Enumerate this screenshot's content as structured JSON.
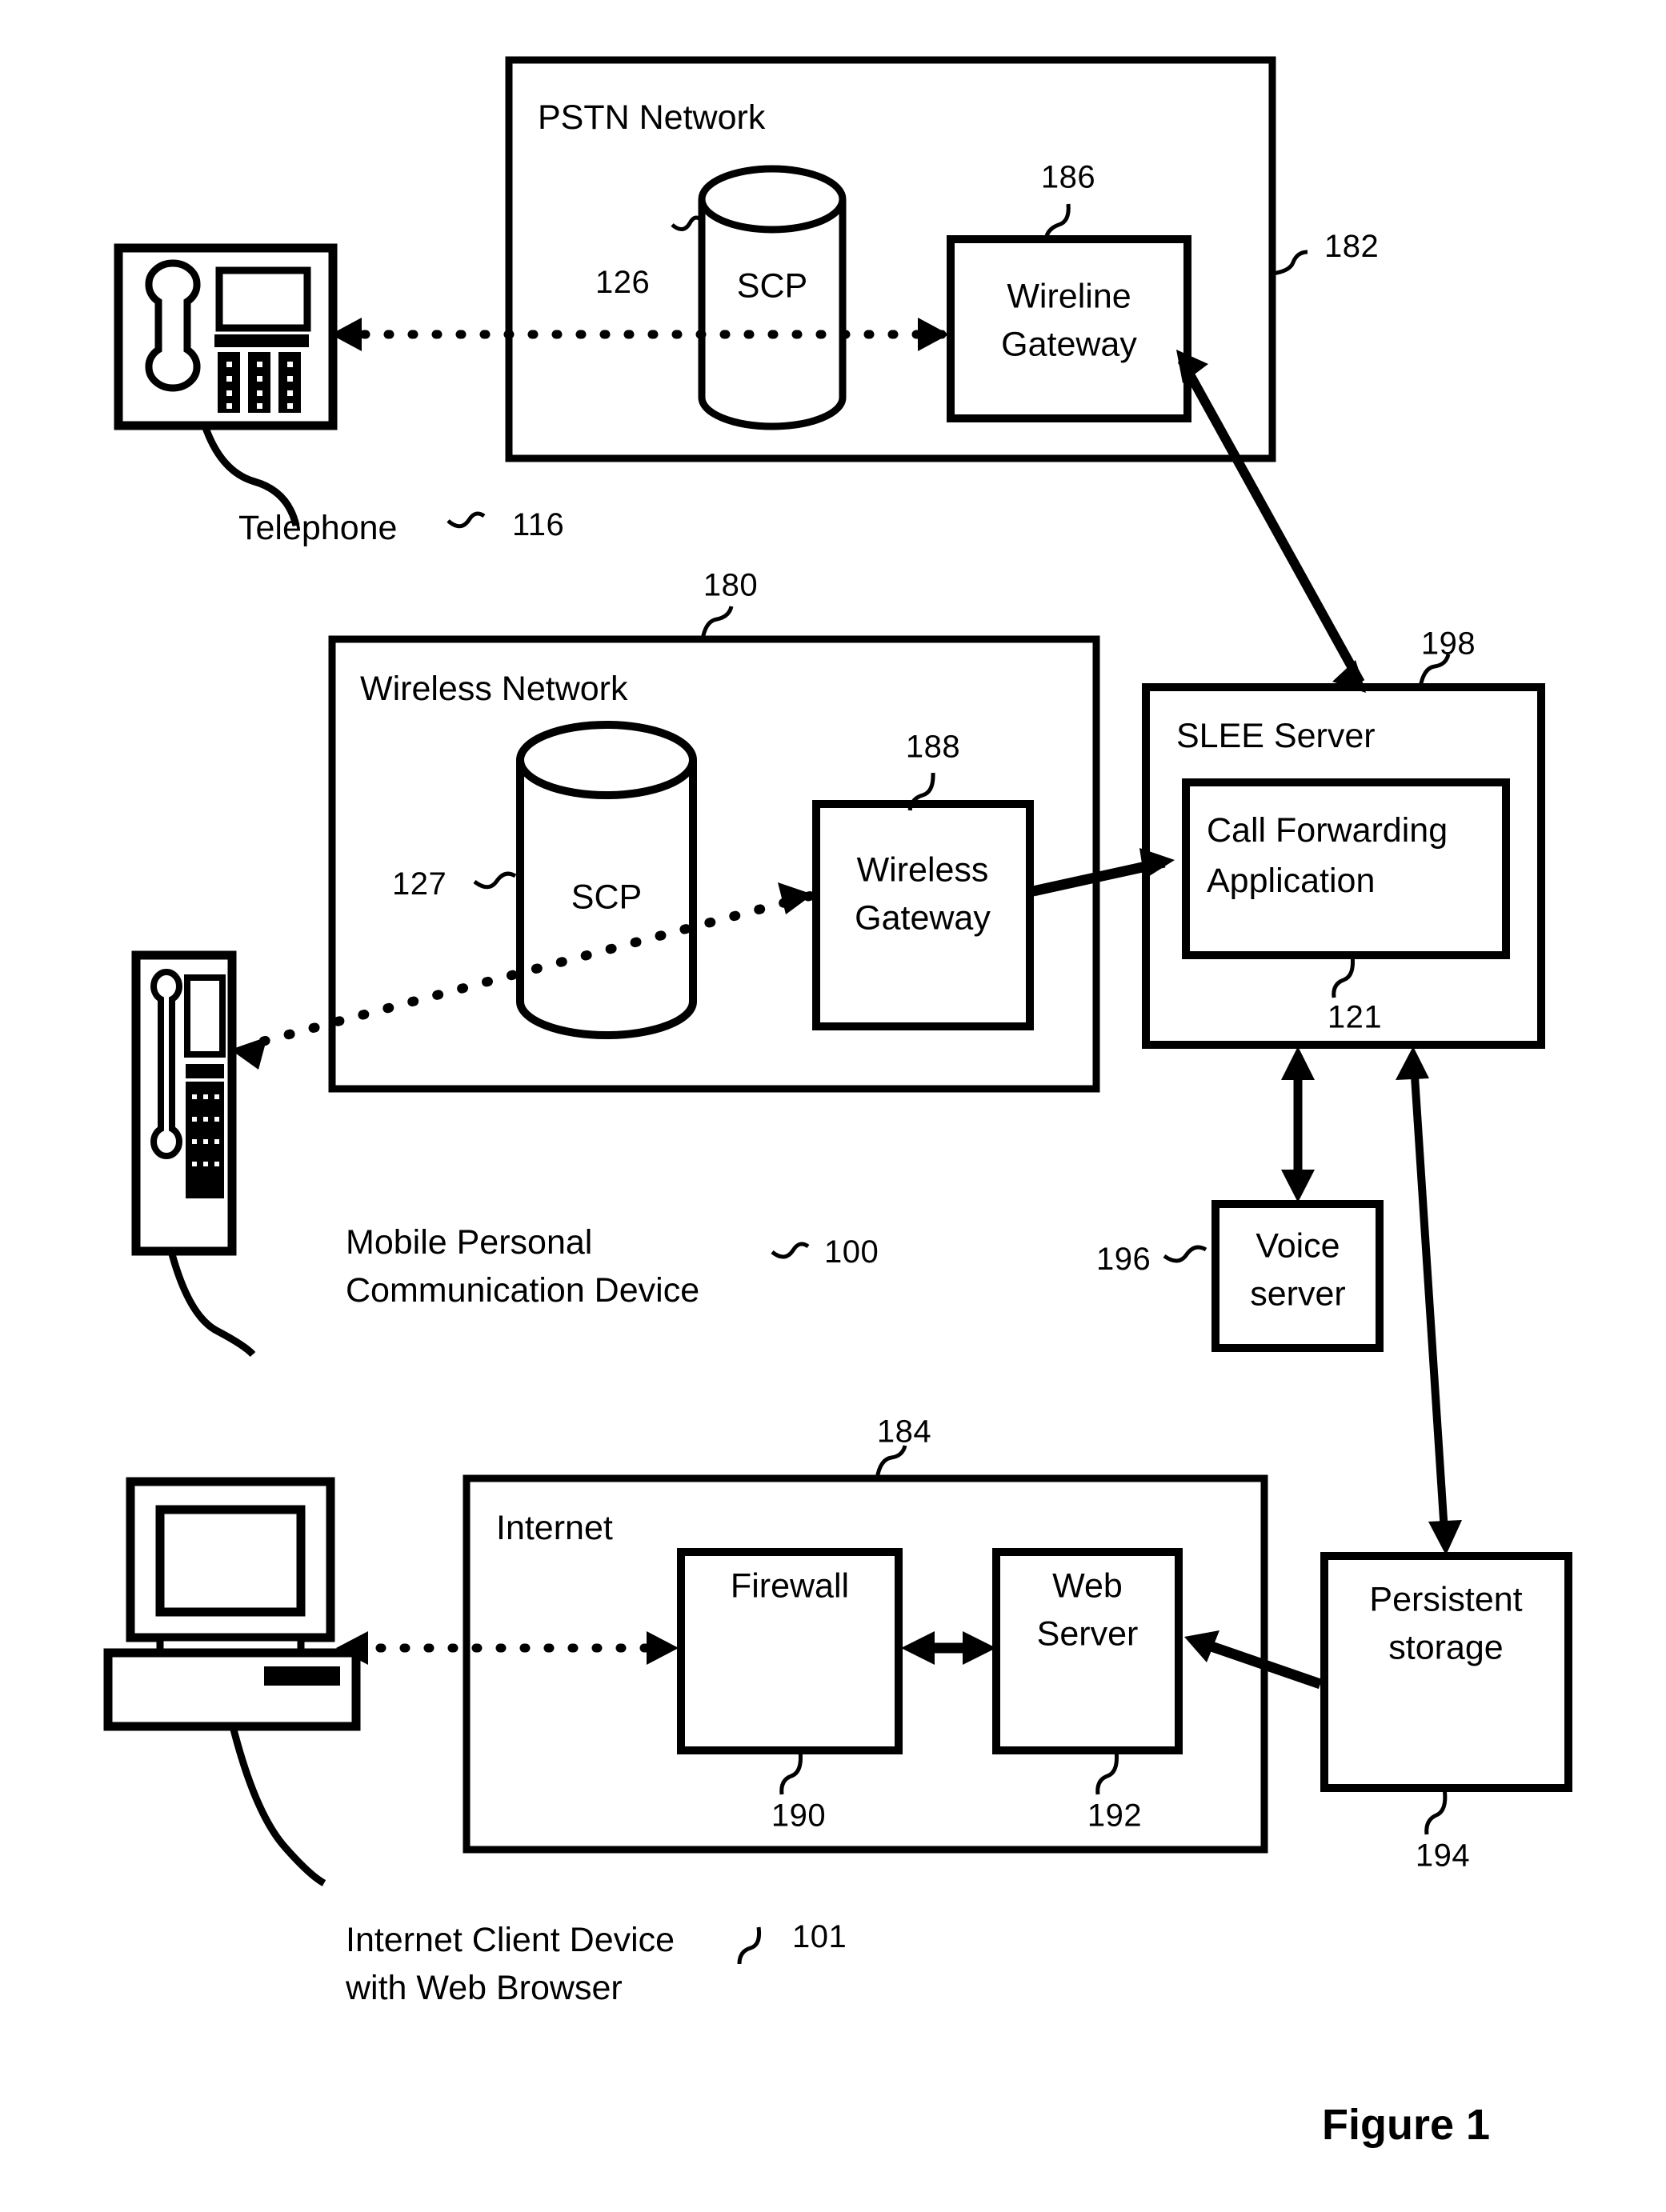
{
  "figure": {
    "caption": "Figure 1",
    "type": "patent-system-block-diagram"
  },
  "containers": {
    "pstn": {
      "title": "PSTN Network",
      "ref": "182"
    },
    "wireless": {
      "title": "Wireless Network",
      "ref": "180"
    },
    "internet": {
      "title": "Internet",
      "ref": "184"
    }
  },
  "nodes": {
    "scp_pstn": {
      "label": "SCP",
      "ref": "126"
    },
    "scp_wireless": {
      "label": "SCP",
      "ref": "127"
    },
    "wireline_gateway": {
      "label_line1": "Wireline",
      "label_line2": "Gateway",
      "ref": "186"
    },
    "wireless_gateway": {
      "label_line1": "Wireless",
      "label_line2": "Gateway",
      "ref": "188"
    },
    "slee_server": {
      "title": "SLEE Server",
      "ref": "198"
    },
    "call_forwarding_app": {
      "label_line1": "Call Forwarding",
      "label_line2": "Application",
      "ref": "121"
    },
    "voice_server": {
      "label_line1": "Voice",
      "label_line2": "server",
      "ref": "196"
    },
    "persistent_storage": {
      "label_line1": "Persistent",
      "label_line2": "storage",
      "ref": "194"
    },
    "firewall": {
      "label": "Firewall",
      "ref": "190"
    },
    "web_server": {
      "label_line1": "Web",
      "label_line2": "Server",
      "ref": "192"
    }
  },
  "devices": {
    "telephone": {
      "label": "Telephone",
      "ref": "116",
      "icon": "desk-telephone-icon"
    },
    "mobile": {
      "label_line1": "Mobile Personal",
      "label_line2": "Communication Device",
      "ref": "100",
      "icon": "mobile-phone-icon"
    },
    "client": {
      "label_line1": "Internet Client Device",
      "label_line2": "with Web Browser",
      "ref": "101",
      "icon": "desktop-computer-icon"
    }
  },
  "colors": {
    "ink": "#000000",
    "paper": "#ffffff"
  }
}
